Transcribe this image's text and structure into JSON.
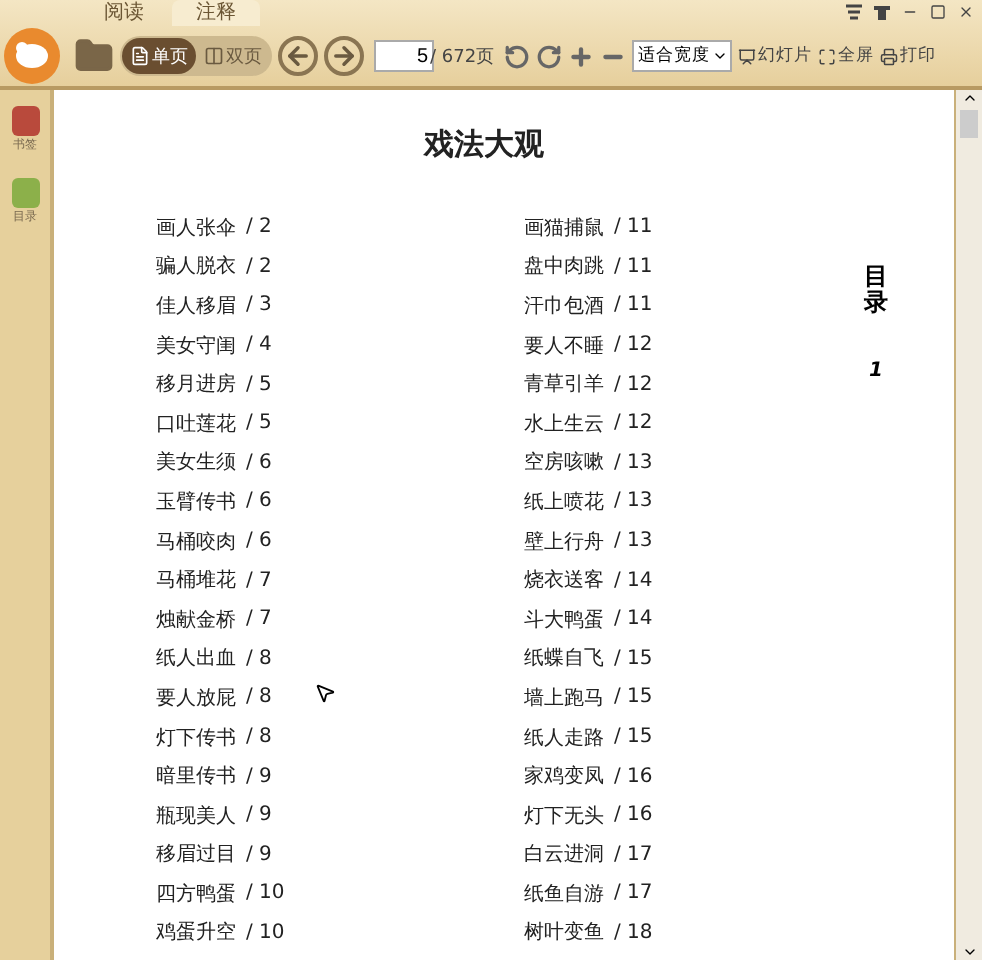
{
  "tabs": [
    {
      "label": "阅读",
      "selected": false
    },
    {
      "label": "注释",
      "selected": true
    }
  ],
  "toolbar": {
    "view_modes": [
      {
        "label": "单页",
        "kind": "single",
        "selected": true
      },
      {
        "label": "双页",
        "kind": "double",
        "selected": false
      }
    ],
    "page_input": "5",
    "page_total": "/ 672页",
    "zoom_select": "适合宽度",
    "actions": [
      {
        "label": "幻灯片",
        "kind": "slideshow"
      },
      {
        "label": "全屏",
        "kind": "fullscreen"
      },
      {
        "label": "打印",
        "kind": "print"
      }
    ]
  },
  "sidebar": {
    "items": [
      {
        "label": "书签",
        "kind": "bookmark"
      },
      {
        "label": "目录",
        "kind": "toc"
      }
    ]
  },
  "page": {
    "title": "戏法大观",
    "side_heading": "目录",
    "page_number": "1",
    "columns": [
      [
        {
          "name": "画人张伞",
          "page": "/ 2"
        },
        {
          "name": "骗人脱衣",
          "page": "/ 2"
        },
        {
          "name": "佳人移眉",
          "page": "/ 3"
        },
        {
          "name": "美女守闺",
          "page": "/ 4"
        },
        {
          "name": "移月进房",
          "page": "/ 5"
        },
        {
          "name": "口吐莲花",
          "page": "/ 5"
        },
        {
          "name": "美女生须",
          "page": "/ 6"
        },
        {
          "name": "玉臂传书",
          "page": "/ 6"
        },
        {
          "name": "马桶咬肉",
          "page": "/ 6"
        },
        {
          "name": "马桶堆花",
          "page": "/ 7"
        },
        {
          "name": "烛献金桥",
          "page": "/ 7"
        },
        {
          "name": "纸人出血",
          "page": "/ 8"
        },
        {
          "name": "要人放屁",
          "page": "/ 8"
        },
        {
          "name": "灯下传书",
          "page": "/ 8"
        },
        {
          "name": "暗里传书",
          "page": "/ 9"
        },
        {
          "name": "瓶现美人",
          "page": "/ 9"
        },
        {
          "name": "移眉过目",
          "page": "/ 9"
        },
        {
          "name": "四方鸭蛋",
          "page": "/ 10"
        },
        {
          "name": "鸡蛋升空",
          "page": "/ 10"
        }
      ],
      [
        {
          "name": "画猫捕鼠",
          "page": "/ 11"
        },
        {
          "name": "盘中肉跳",
          "page": "/ 11"
        },
        {
          "name": "汗巾包酒",
          "page": "/ 11"
        },
        {
          "name": "要人不睡",
          "page": "/ 12"
        },
        {
          "name": "青草引羊",
          "page": "/ 12"
        },
        {
          "name": "水上生云",
          "page": "/ 12"
        },
        {
          "name": "空房咳嗽",
          "page": "/ 13"
        },
        {
          "name": "纸上喷花",
          "page": "/ 13"
        },
        {
          "name": "壁上行舟",
          "page": "/ 13"
        },
        {
          "name": "烧衣送客",
          "page": "/ 14"
        },
        {
          "name": "斗大鸭蛋",
          "page": "/ 14"
        },
        {
          "name": "纸蝶自飞",
          "page": "/ 15"
        },
        {
          "name": "墙上跑马",
          "page": "/ 15"
        },
        {
          "name": "纸人走路",
          "page": "/ 15"
        },
        {
          "name": "家鸡变凤",
          "page": "/ 16"
        },
        {
          "name": "灯下无头",
          "page": "/ 16"
        },
        {
          "name": "白云进洞",
          "page": "/ 17"
        },
        {
          "name": "纸鱼自游",
          "page": "/ 17"
        },
        {
          "name": "树叶变鱼",
          "page": "/ 18"
        }
      ]
    ]
  }
}
